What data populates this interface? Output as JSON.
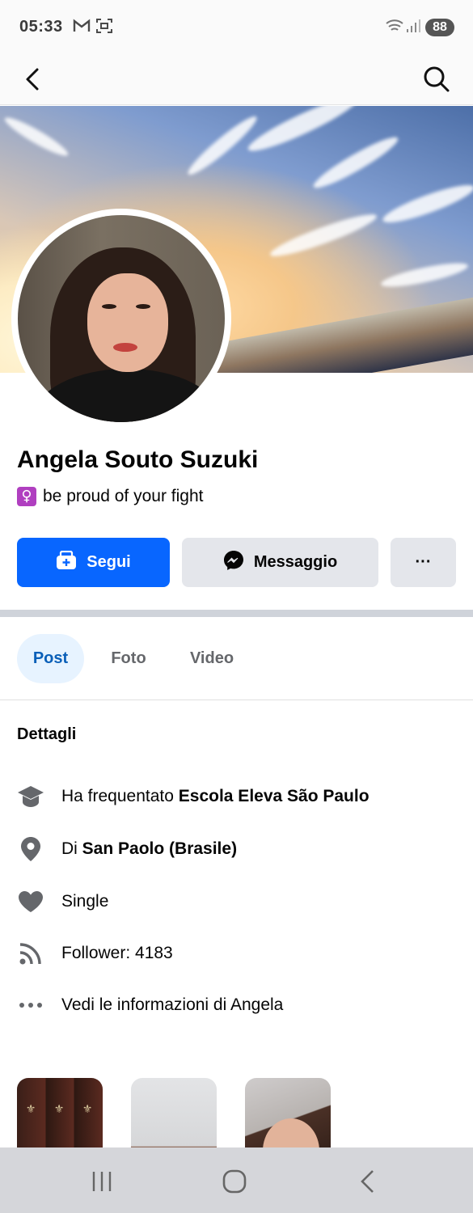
{
  "status_bar": {
    "time": "05:33",
    "battery": "88",
    "icons": [
      "gmail-icon",
      "screen-capture-icon",
      "wifi-icon",
      "signal-icon"
    ]
  },
  "top_nav": {
    "back_icon": "arrow-left-icon",
    "search_icon": "search-icon"
  },
  "profile": {
    "name": "Angela Souto Suzuki",
    "bio_emoji": "♀",
    "bio_text": "be proud of your fight"
  },
  "actions": {
    "follow_label": "Segui",
    "message_label": "Messaggio",
    "more_label": "···"
  },
  "tabs": [
    {
      "label": "Post",
      "active": true
    },
    {
      "label": "Foto",
      "active": false
    },
    {
      "label": "Video",
      "active": false
    }
  ],
  "details": {
    "title": "Dettagli",
    "items": [
      {
        "icon": "graduation-cap-icon",
        "prefix": "Ha frequentato ",
        "bold": "Escola Eleva São Paulo"
      },
      {
        "icon": "location-pin-icon",
        "prefix": "Di ",
        "bold": "San Paolo (Brasile)"
      },
      {
        "icon": "heart-icon",
        "prefix": "Single",
        "bold": ""
      },
      {
        "icon": "rss-feed-icon",
        "prefix": "Follower: 4183",
        "bold": ""
      },
      {
        "icon": "more-dots-icon",
        "prefix": "Vedi le informazioni di Angela",
        "bold": ""
      }
    ]
  },
  "colors": {
    "accent": "#0866ff",
    "secondary_button": "#e4e6eb",
    "active_tab_bg": "#e7f3ff",
    "active_tab_text": "#0a5fb8"
  },
  "bottom_nav": {
    "icons": [
      "recent-apps-icon",
      "home-icon",
      "back-icon"
    ]
  }
}
